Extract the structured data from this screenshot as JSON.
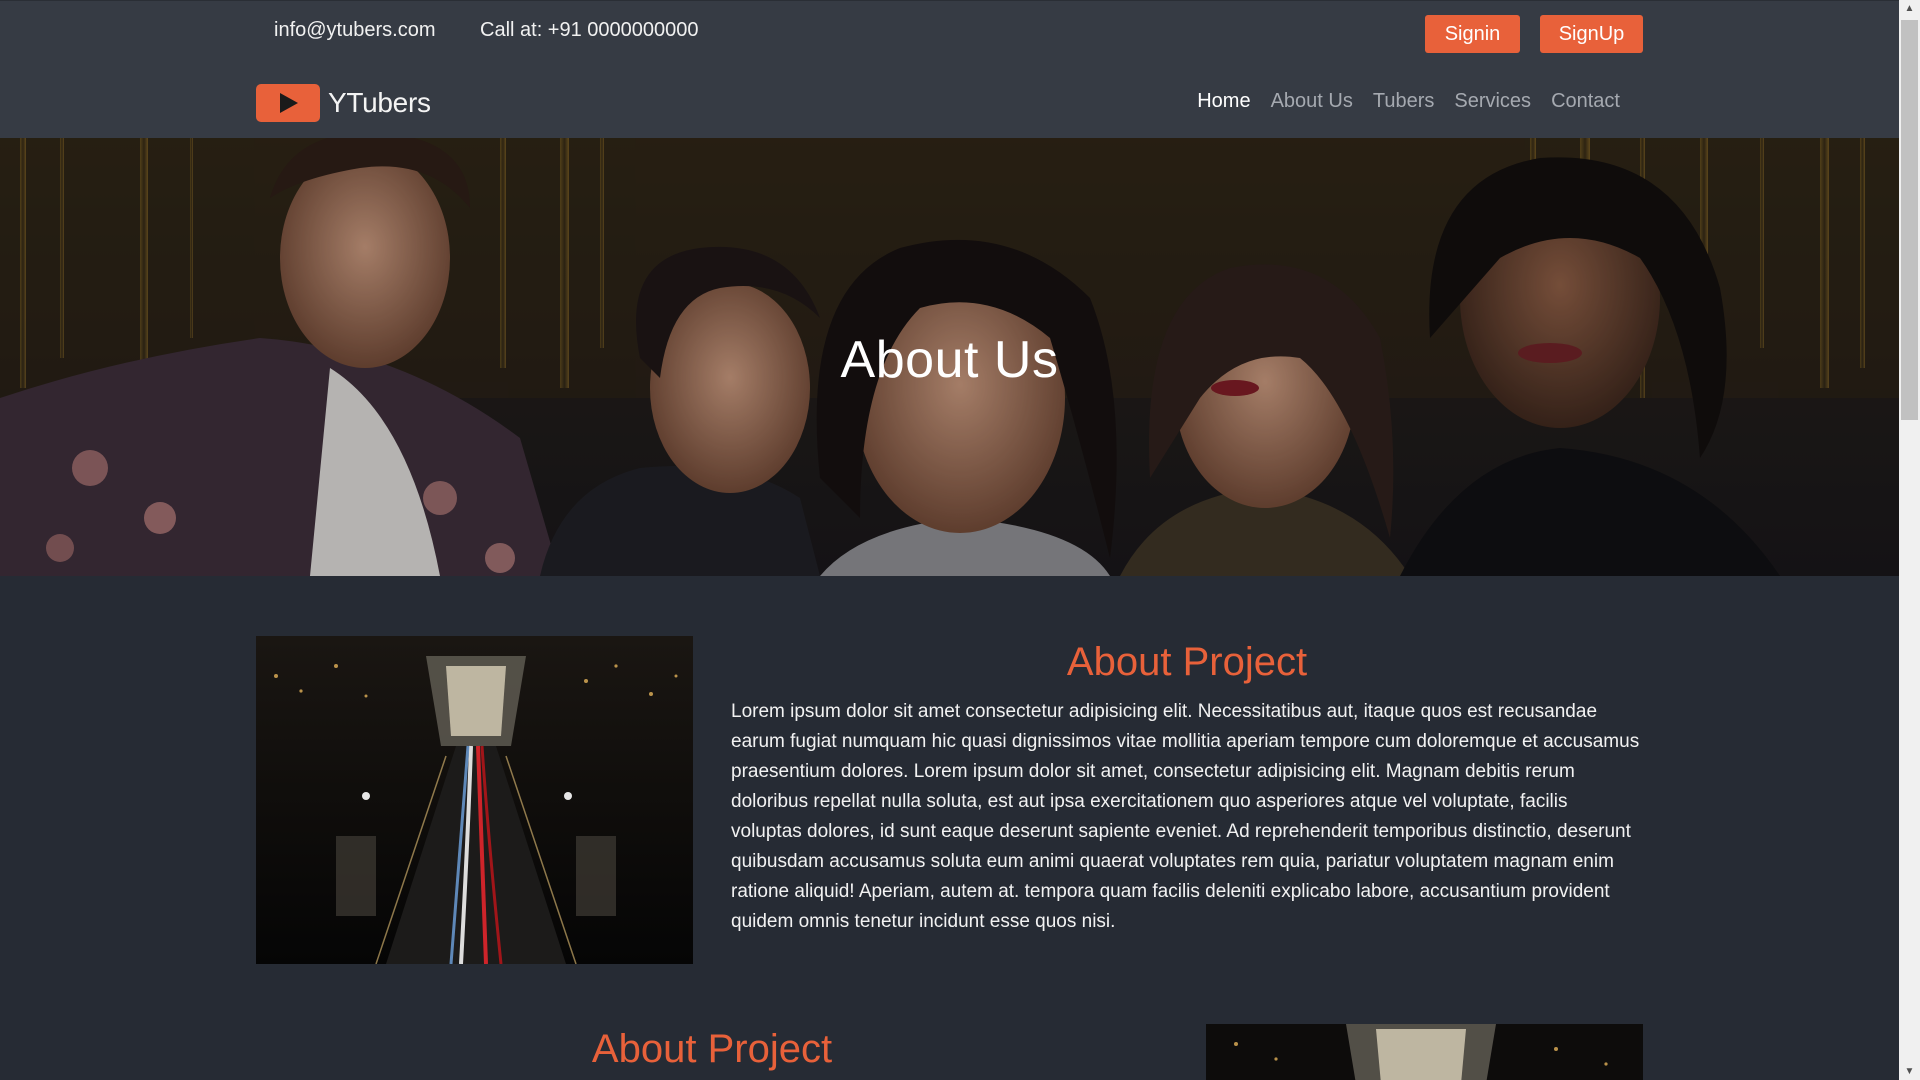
{
  "topbar": {
    "email": "info@ytubers.com",
    "phone": "Call at: +91 0000000000",
    "signin_label": "Signin",
    "signup_label": "SignUp"
  },
  "navbar": {
    "brand": "YTubers",
    "links": [
      "Home",
      "About Us",
      "Tubers",
      "Services",
      "Contact"
    ],
    "active": "Home"
  },
  "hero": {
    "title": "About Us"
  },
  "about_sections": [
    {
      "title": "About Project",
      "text": "Lorem ipsum dolor sit amet consectetur adipisicing elit. Necessitatibus aut, itaque quos est recusandae earum fugiat numquam hic quasi dignissimos vitae mollitia aperiam tempore cum doloremque et accusamus praesentium dolores. Lorem ipsum dolor sit amet, consectetur adipisicing elit. Magnam debitis rerum doloribus repellat nulla soluta, est aut ipsa exercitationem quo asperiores atque vel voluptate, facilis voluptas dolores, id sunt eaque deserunt sapiente eveniet. Ad reprehenderit temporibus distinctio, deserunt quibusdam accusamus soluta eum animi quaerat voluptates rem quia, pariatur voluptatem magnam enim ratione aliquid! Aperiam, autem at. tempora quam facilis deleniti explicabo labore, accusantium provident quidem omnis tenetur incidunt esse quos nisi."
    },
    {
      "title": "About Project"
    }
  ],
  "colors": {
    "accent": "#e8613a",
    "header_bg": "#363b44",
    "page_bg": "#262b34"
  },
  "icons": {
    "logo": "play-icon",
    "scroll_up": "arrow-up-icon",
    "scroll_down": "arrow-down-icon"
  }
}
